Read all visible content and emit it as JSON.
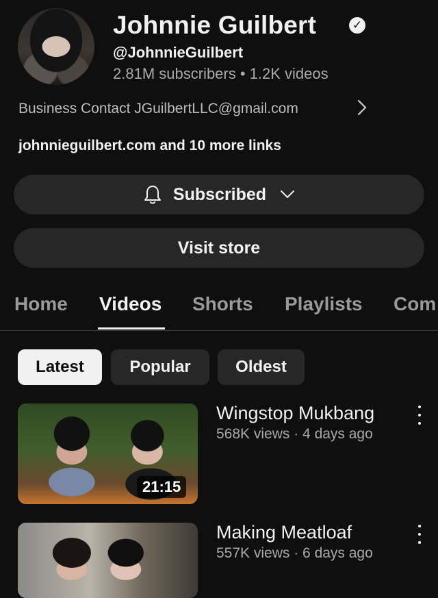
{
  "channel": {
    "name": "Johnnie Guilbert",
    "handle": "@JohnnieGuilbert",
    "stats": "2.81M subscribers • 1.2K videos",
    "business_contact": "Business Contact JGuilbertLLC@gmail.com",
    "links": "johnnieguilbert.com and 10 more links"
  },
  "buttons": {
    "subscribe_label": "Subscribed",
    "store_label": "Visit store"
  },
  "tabs": [
    {
      "label": "Home"
    },
    {
      "label": "Videos"
    },
    {
      "label": "Shorts"
    },
    {
      "label": "Playlists"
    },
    {
      "label": "Com"
    }
  ],
  "active_tab": "Videos",
  "chips": [
    {
      "label": "Latest"
    },
    {
      "label": "Popular"
    },
    {
      "label": "Oldest"
    }
  ],
  "selected_chip": "Latest",
  "videos": [
    {
      "title": "Wingstop Mukbang",
      "meta": "568K views · 4 days ago",
      "duration": "21:15"
    },
    {
      "title": "Making Meatloaf",
      "meta": "557K views · 6 days ago"
    }
  ],
  "icons": {
    "verified": "verified-check-icon",
    "bell": "bell-icon",
    "chevron_down": "chevron-down-icon",
    "chevron_right": "chevron-right-icon",
    "more": "more-vert-icon"
  },
  "colors": {
    "background": "#0f0f0f",
    "surface": "#272727",
    "text_primary": "#f1f1f1",
    "text_secondary": "#aaaaaa"
  }
}
